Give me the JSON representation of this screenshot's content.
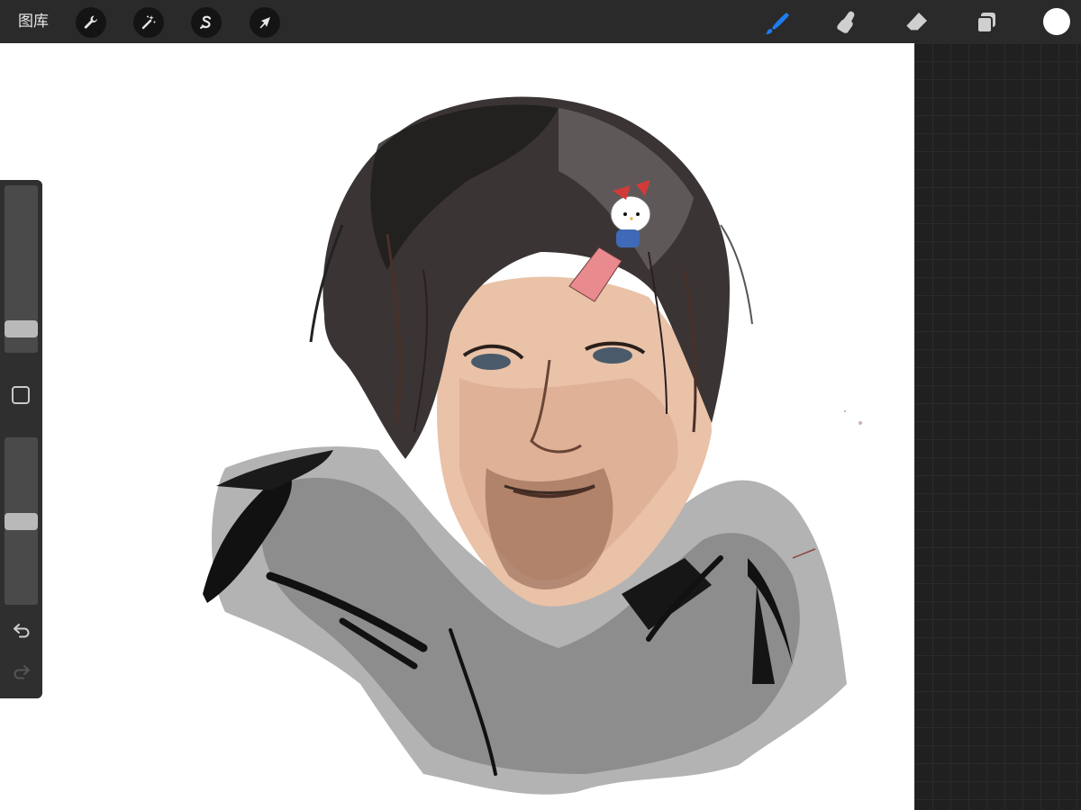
{
  "toolbar": {
    "gallery_label": "图库",
    "left_tools": [
      {
        "name": "actions",
        "icon": "wrench-icon"
      },
      {
        "name": "adjustments",
        "icon": "magic-wand-icon"
      },
      {
        "name": "selection",
        "icon": "selection-s-icon"
      },
      {
        "name": "transform",
        "icon": "arrow-cursor-icon"
      }
    ],
    "right_tools": [
      {
        "name": "brush",
        "icon": "brush-icon",
        "active": true,
        "color": "#1e7cf2"
      },
      {
        "name": "smudge",
        "icon": "smudge-finger-icon",
        "active": false
      },
      {
        "name": "eraser",
        "icon": "eraser-icon",
        "active": false
      },
      {
        "name": "layers",
        "icon": "layers-icon",
        "active": false
      }
    ],
    "current_color": "#ffffff"
  },
  "sidebar": {
    "brush_size_level": 0.1,
    "opacity_level": 0.5,
    "modify_button": "square-icon",
    "undo": "undo-icon",
    "redo": "redo-icon"
  },
  "canvas": {
    "artwork": "portrait-illustration"
  },
  "colors": {
    "toolbar_bg": "#2a2a2a",
    "canvas_bg": "#ffffff",
    "workspace_bg": "#202020",
    "accent": "#1e7cf2"
  }
}
